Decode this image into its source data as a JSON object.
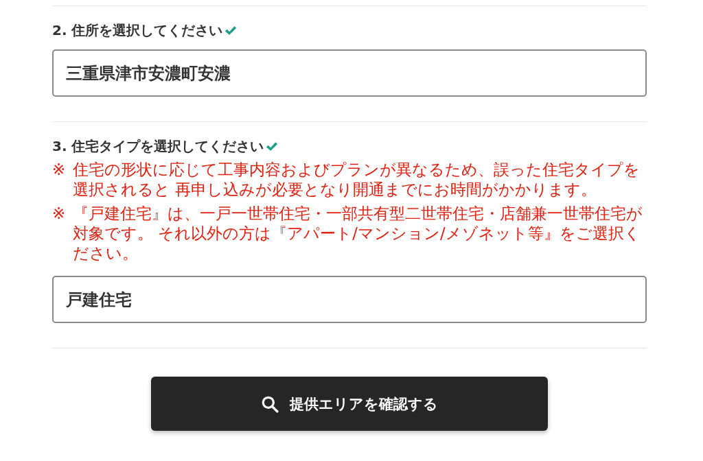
{
  "sections": [
    {
      "heading": "2. 住所を選択してください",
      "completed": true,
      "value": "三重県津市安濃町安濃"
    },
    {
      "heading": "3. 住宅タイプを選択してください",
      "completed": true,
      "notes": [
        {
          "mark": "※",
          "text": "住宅の形状に応じて工事内容およびプランが異なるため、誤った住宅タイプを選択されると 再申し込みが必要となり開通までにお時間がかかります。"
        },
        {
          "mark": "※",
          "text": "『戸建住宅』は、一戸一世帯住宅・一部共有型二世帯住宅・店舗兼一世帯住宅が対象です。 それ以外の方は『アパート/マンション/メゾネット等』をご選択ください。"
        }
      ],
      "value": "戸建住宅"
    }
  ],
  "button": {
    "label": "提供エリアを確認する"
  }
}
